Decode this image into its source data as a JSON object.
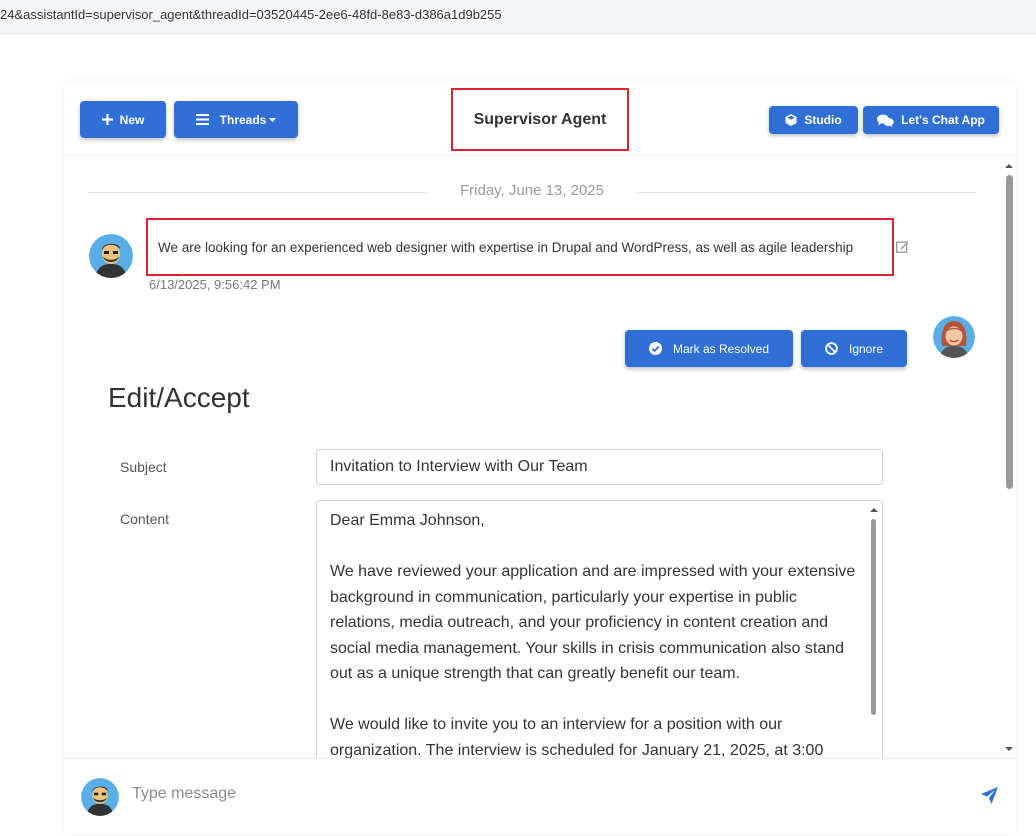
{
  "browser": {
    "url": "24&assistantId=supervisor_agent&threadId=03520445-2ee6-48fd-8e83-d386a1d9b255"
  },
  "header": {
    "new_label": "New",
    "threads_label": "Threads",
    "title": "Supervisor Agent",
    "studio_label": "Studio",
    "chat_app_label": "Let's Chat App"
  },
  "chat": {
    "date": "Friday, June 13, 2025",
    "user_message": "We are looking for an experienced web designer with expertise in Drupal and WordPress, as well as agile leadership",
    "user_timestamp": "6/13/2025, 9:56:42 PM",
    "resolve_label": "Mark as Resolved",
    "ignore_label": "Ignore"
  },
  "form": {
    "title": "Edit/Accept",
    "subject_label": "Subject",
    "subject_value": "Invitation to Interview with Our Team",
    "content_label": "Content",
    "content_paragraphs": [
      "Dear Emma Johnson,",
      "We have reviewed your application and are impressed with your extensive background in communication, particularly your expertise in public relations, media outreach, and your proficiency in content creation and social media management. Your skills in crisis communication also stand out as a unique strength that can greatly benefit our team.",
      "We would like to invite you to an interview for a position with our organization. The interview is scheduled for January 21, 2025, at 3:00"
    ]
  },
  "composer": {
    "placeholder": "Type message"
  },
  "icons": {
    "new": "plus-icon",
    "threads": "menu-icon",
    "studio": "cube-icon",
    "chat_app": "chat-bubbles-icon",
    "resolve": "check-circle-icon",
    "ignore": "ban-icon",
    "edit": "edit-icon",
    "send": "send-icon"
  },
  "colors": {
    "primary": "#2f6fd6",
    "highlight": "#d9262e"
  }
}
